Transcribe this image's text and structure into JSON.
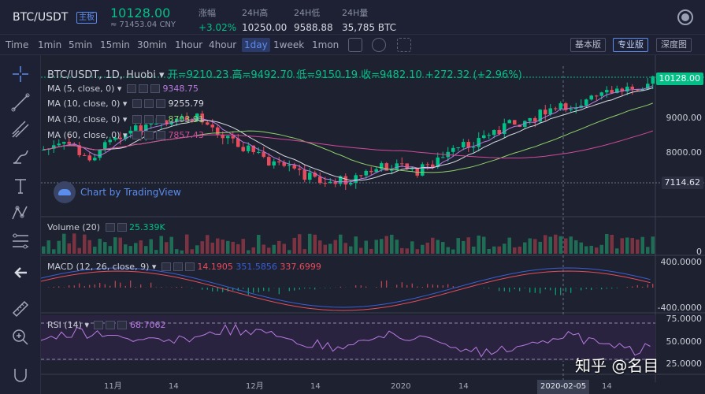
{
  "header": {
    "pair": "BTC/USDT",
    "badge": "主板",
    "price": "10128.00",
    "cny": "≈ 71453.04 CNY",
    "stats": [
      {
        "label": "涨幅",
        "value": "+3.02%"
      },
      {
        "label": "24H高",
        "value": "10250.00"
      },
      {
        "label": "24H低",
        "value": "9588.88"
      },
      {
        "label": "24H量",
        "value": "35,785 BTC"
      }
    ]
  },
  "toolbar": {
    "intervals": [
      "Time",
      "1min",
      "5min",
      "15min",
      "30min",
      "1hour",
      "4hour",
      "1day",
      "1week",
      "1mon"
    ],
    "active_interval": "1day",
    "views": [
      "基本版",
      "专业版",
      "深度图"
    ],
    "active_view": "专业版"
  },
  "chart": {
    "title": "BTC/USDT, 1D, Huobi",
    "open_label": "开=9210.23",
    "high_label": "高=9492.70",
    "low_label": "低=9150.19",
    "close_label": "收=9482.10",
    "change_label": "+272.32 (+2.96%)",
    "ma": [
      {
        "label": "MA (5, close, 0)",
        "value": "9348.75",
        "color": "#b77be0"
      },
      {
        "label": "MA (10, close, 0)",
        "value": "9255.79",
        "color": "#d6d9e2"
      },
      {
        "label": "MA (30, close, 0)",
        "value": "8703.91",
        "color": "#8fd16a"
      },
      {
        "label": "MA (60, close, 0)",
        "value": "7857.43",
        "color": "#d14b9b"
      }
    ],
    "tv_logo": "Chart by TradingView",
    "price_axis": [
      "9000.00",
      "8000.00"
    ],
    "current_price_tag": "10128.00",
    "low_tag": "7114.62",
    "volume": {
      "label": "Volume (20)",
      "value": "25.339K",
      "axis": "0"
    },
    "macd": {
      "label": "MACD (12, 26, close, 9)",
      "v1": "14.1905",
      "v2": "351.5856",
      "v3": "337.6999",
      "axis": [
        "400.0000",
        "-400.0000"
      ]
    },
    "rsi": {
      "label": "RSI (14)",
      "value": "68.7062",
      "axis": [
        "75.0000",
        "50.0000",
        "25.0000"
      ]
    },
    "dates": [
      "11月",
      "14",
      "12月",
      "14",
      "2020",
      "14",
      "14"
    ],
    "date_tag": "2020-02-05",
    "watermark": "知乎 @名目"
  }
}
